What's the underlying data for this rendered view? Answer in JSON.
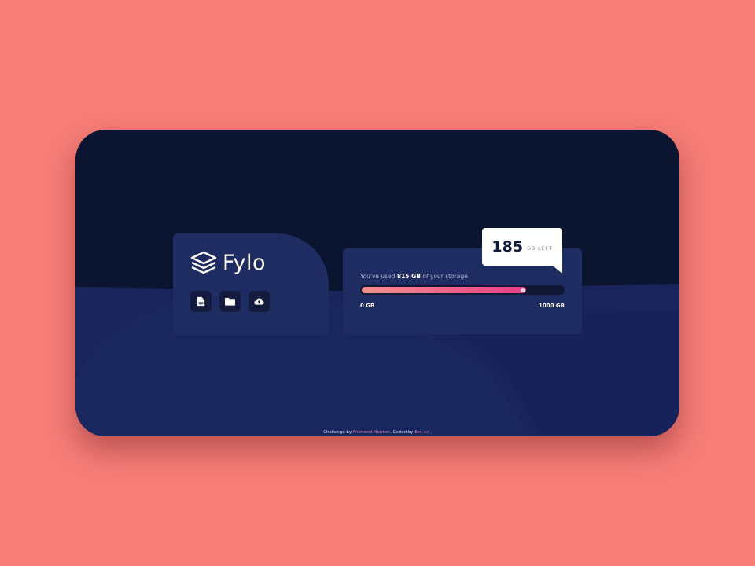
{
  "brand": {
    "name": "Fylo",
    "logo_icon": "layers-icon"
  },
  "actions": [
    {
      "icon": "document-icon"
    },
    {
      "icon": "folder-icon"
    },
    {
      "icon": "cloud-upload-icon"
    }
  ],
  "storage": {
    "usage_prefix": "You've used",
    "used": "815 GB",
    "usage_suffix": "of your storage",
    "min_label": "0 GB",
    "max_label": "1000 GB",
    "used_fraction": 0.815,
    "remaining_number": "185",
    "remaining_unit": "GB LEFT"
  },
  "footer": {
    "challenge_prefix": "Challenge by",
    "challenge_link": "Frontend Mentor",
    "coded_prefix": ". Coded by",
    "author_link": "Ezu-ez",
    "end": "."
  },
  "colors": {
    "page_background": "#f77d78",
    "app_background": "#0c1530",
    "card_background": "#1f2c62",
    "gradient_start": "#f8918c",
    "gradient_end": "#e73d87"
  }
}
